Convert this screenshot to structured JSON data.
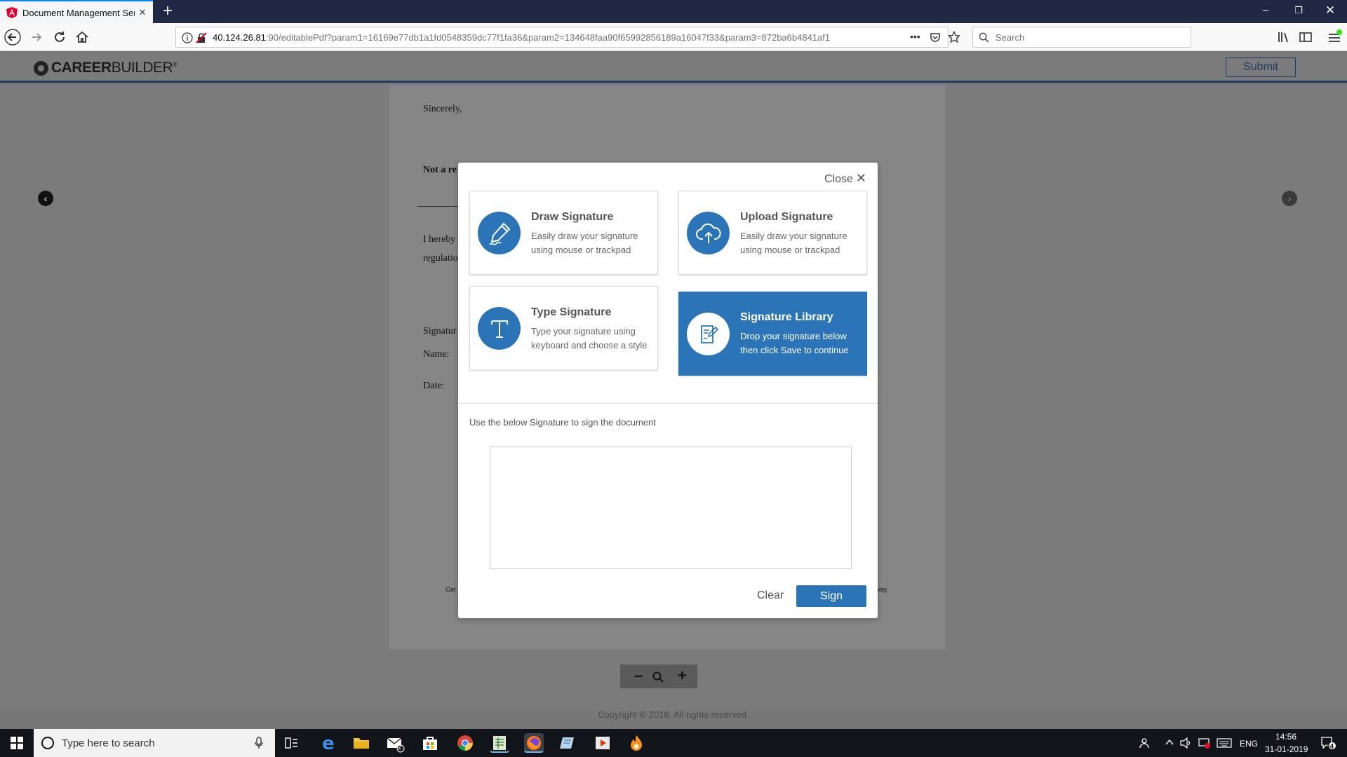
{
  "browser": {
    "tab_title": "Document Management Servic",
    "url_host": "40.124.26.81",
    "url_path": ":90/editablePdf?param1=16169e77db1a1fd0548359dc77f1fa36&param2=134648faa90f65992856189a16047f33&param3=872ba6b4841af1",
    "search_placeholder": "Search",
    "url_menu_glyph": "•••"
  },
  "app": {
    "logo_bold": "CAREER",
    "logo_light": "BUILDER",
    "logo_reg": "®",
    "submit_label": "Submit"
  },
  "document": {
    "lines": {
      "sincerely": "Sincerely,",
      "not_a_re": "Not a re",
      "i_hereby": "I hereby",
      "regulatio": "regulatio",
      "signature": "Signatur",
      "name": "Name:",
      "date": "Date:"
    },
    "footnote_left": "Car",
    "footnote_right": "vay,"
  },
  "modal": {
    "close_label": "Close",
    "close_glyph": "✕",
    "options": [
      {
        "title": "Draw Signature",
        "desc": "Easily draw your signature using mouse or trackpad",
        "icon": "pencil-icon",
        "active": false
      },
      {
        "title": "Upload Signature",
        "desc": "Easily draw your signature using mouse or trackpad",
        "icon": "cloud-upload-icon",
        "active": false
      },
      {
        "title": "Type Signature",
        "desc": "Type your signature using keyboard and choose a style",
        "icon": "text-t-icon",
        "active": false
      },
      {
        "title": "Signature Library",
        "desc": "Drop your signature below then click Save to continue",
        "icon": "signature-document-icon",
        "active": true
      }
    ],
    "instruction": "Use the below Signature to sign the document",
    "clear_label": "Clear",
    "sign_label": "Sign"
  },
  "viewer": {
    "copyright": "Copyright © 2018. All rights reserved."
  },
  "taskbar": {
    "search_placeholder": "Type here to search",
    "language": "ENG",
    "time": "14:56",
    "date": "31-01-2019",
    "notification_count": "24",
    "mail_badge": "2"
  },
  "colors": {
    "accent": "#2b74b8",
    "chrome_dark": "#1f2743",
    "header_line": "#1e3c66"
  }
}
